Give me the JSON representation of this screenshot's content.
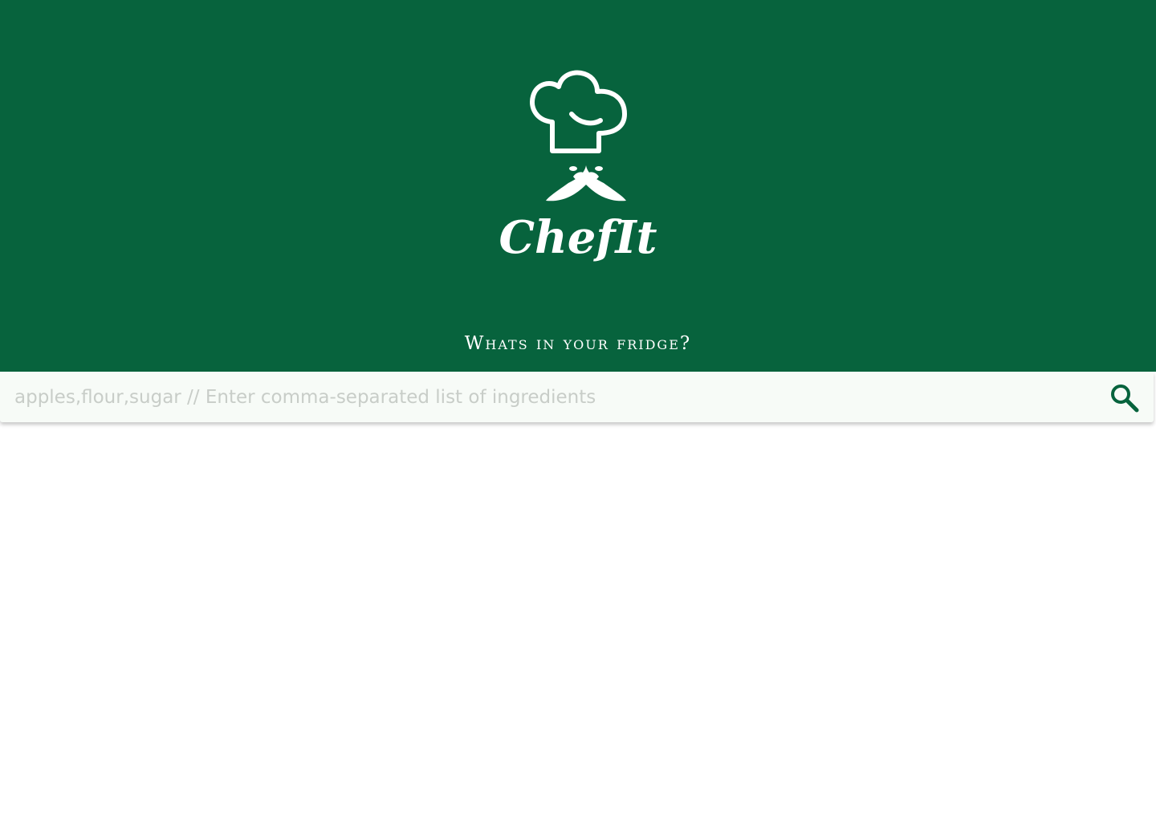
{
  "app": {
    "name": "ChefIt",
    "prompt": "Whats in your fridge?"
  },
  "search": {
    "value": "",
    "placeholder": "apples,flour,sugar // Enter comma-separated list of ingredients"
  },
  "icons": {
    "logo": "chef-hat-mustache-icon",
    "search": "search-icon"
  },
  "colors": {
    "brand_green": "#07633d",
    "search_background": "#f7fbf7",
    "page_background": "#ffffff"
  }
}
